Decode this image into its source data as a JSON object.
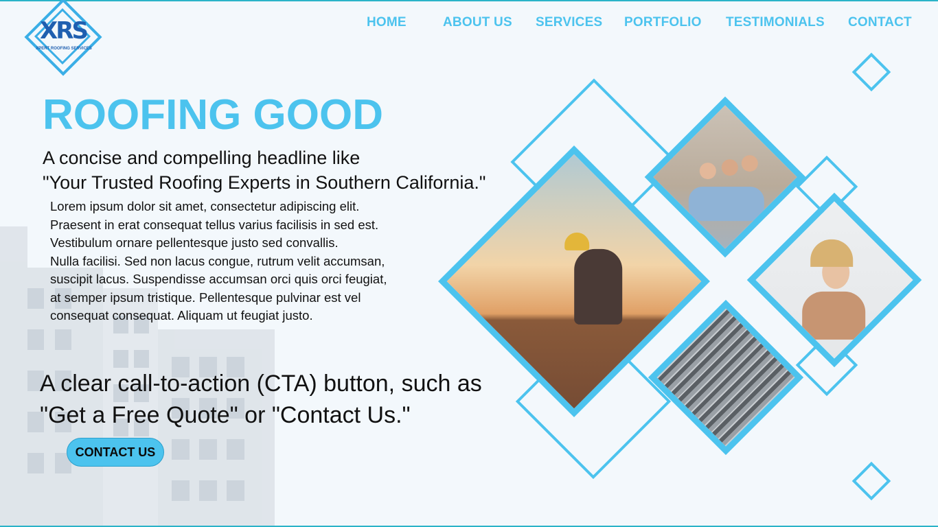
{
  "logo": {
    "mark": "XRS",
    "subtitle": "XPERT ROOFING SERVICES"
  },
  "nav": {
    "items": [
      {
        "label": "HOME"
      },
      {
        "label": "ABOUT US"
      },
      {
        "label": "SERVICES"
      },
      {
        "label": "PORTFOLIO"
      },
      {
        "label": "TESTIMONIALS"
      },
      {
        "label": "CONTACT"
      }
    ]
  },
  "hero": {
    "headline": "ROOFING GOOD",
    "subhead_line1": "A concise and compelling headline like",
    "subhead_line2": "\"Your Trusted Roofing Experts in Southern California.\"",
    "body": [
      "Lorem ipsum dolor sit amet, consectetur adipiscing elit.",
      "Praesent in erat consequat tellus varius facilisis in sed est.",
      "Vestibulum ornare pellentesque justo sed convallis.",
      "Nulla facilisi. Sed non lacus congue, rutrum velit accumsan,",
      "suscipit lacus. Suspendisse accumsan orci quis orci feugiat,",
      "at semper ipsum tristique. Pellentesque pulvinar est vel",
      "consequat consequat. Aliquam ut feugiat justo."
    ],
    "cta_line1": "A clear call-to-action (CTA) button, such as",
    "cta_line2": "\"Get a Free Quote\" or \"Contact Us.\"",
    "cta_button": "CONTACT US"
  },
  "colors": {
    "accent": "#4cc3ee",
    "logo_blue": "#1f5fb0",
    "background": "#f3f8fc"
  },
  "images": [
    {
      "name": "roofer-photo"
    },
    {
      "name": "family-photo"
    },
    {
      "name": "happy-woman-photo"
    },
    {
      "name": "metal-roof-photo"
    }
  ]
}
